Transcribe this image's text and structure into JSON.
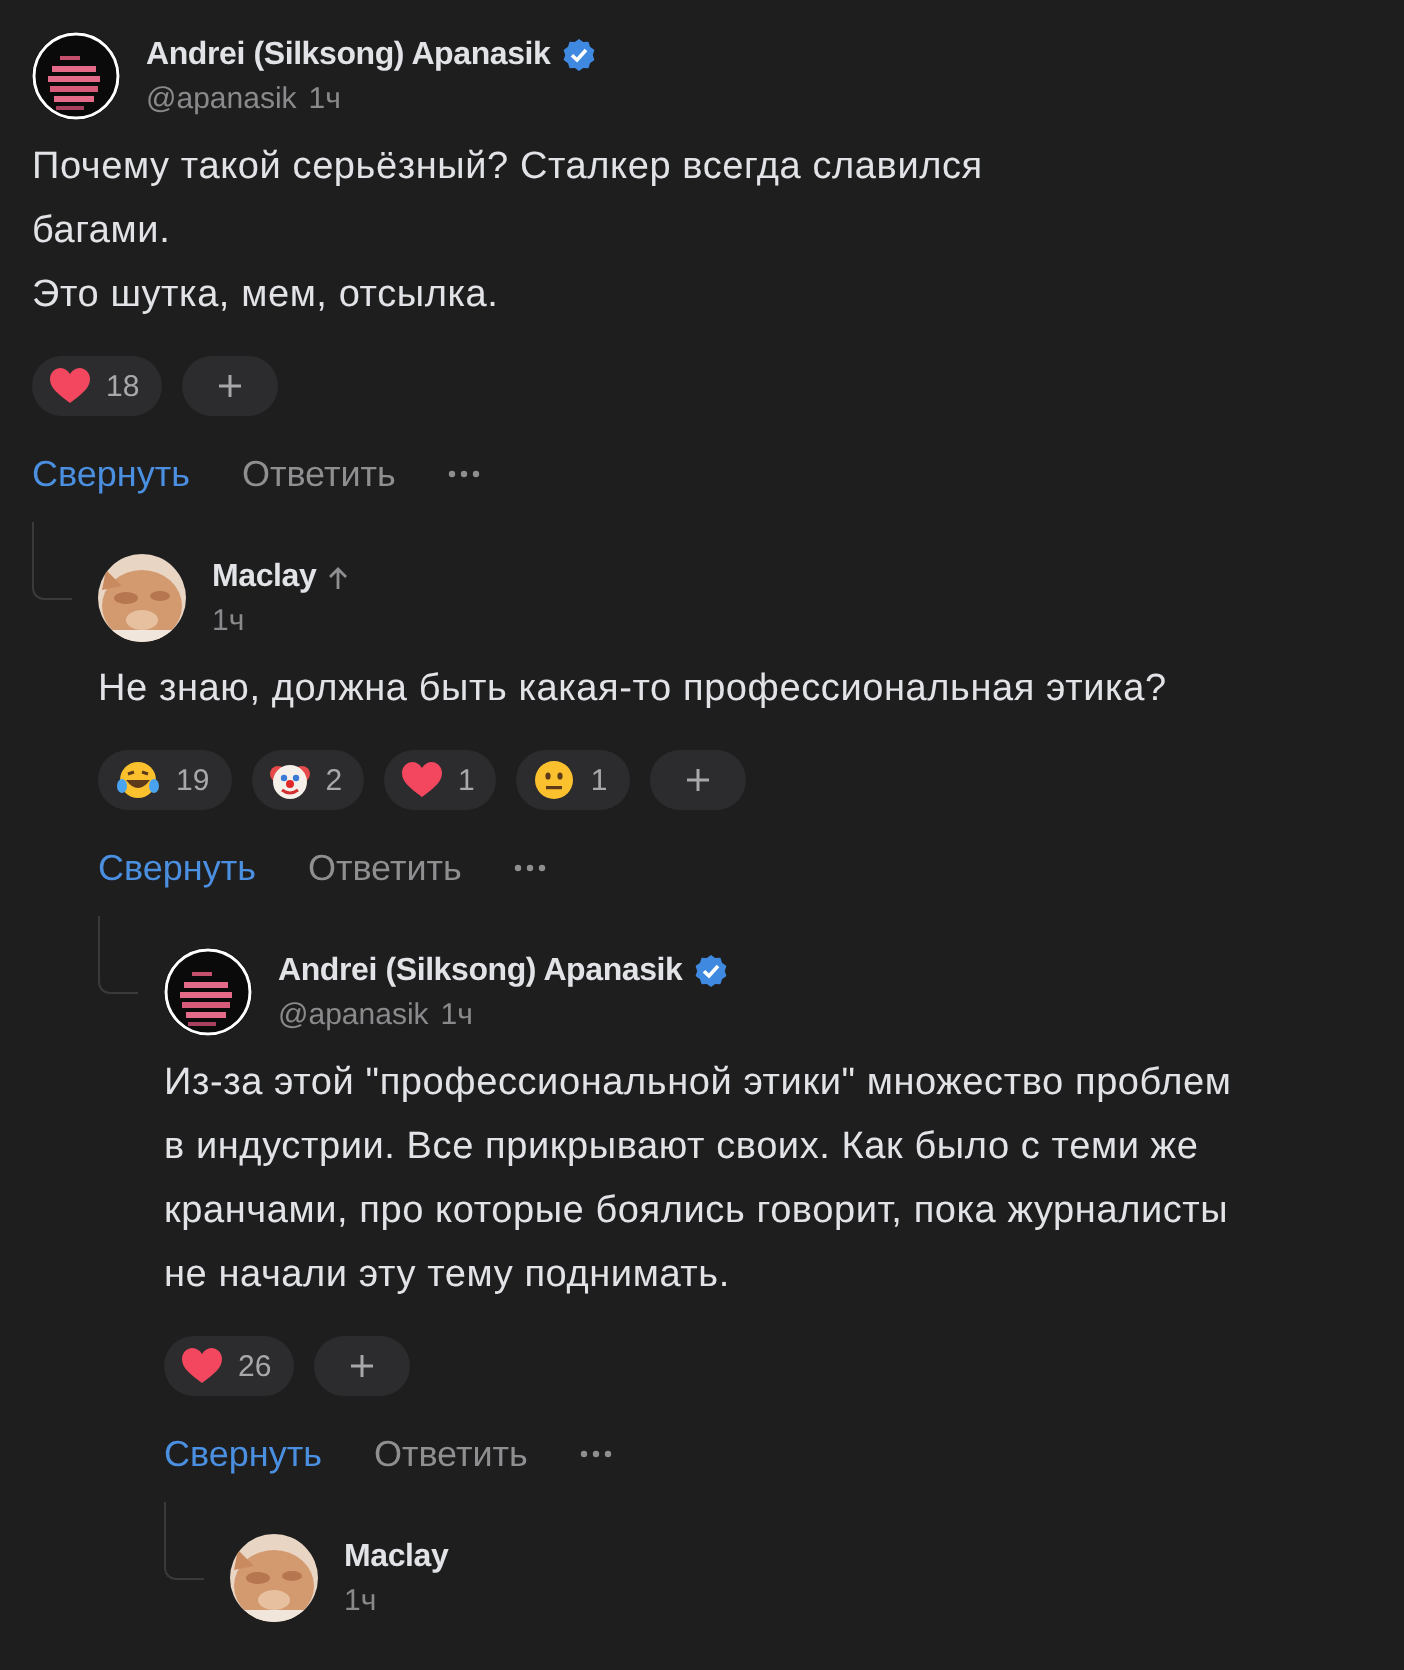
{
  "comments": [
    {
      "author": "Andrei (Silksong) Apanasik",
      "verified": true,
      "reply_marker": false,
      "handle": "@apanasik",
      "time": "1ч",
      "text": "Почему такой серьёзный? Сталкер всегда славился багами.\nЭто шутка, мем, отсылка.",
      "reactions": [
        {
          "kind": "heart",
          "count": "18"
        }
      ],
      "actions": {
        "collapse": "Свернуть",
        "reply": "Ответить"
      },
      "children": [
        {
          "author": "Maclay",
          "verified": false,
          "reply_marker": true,
          "time": "1ч",
          "text": "Не знаю, должна быть какая-то профессиональная этика?",
          "reactions": [
            {
              "kind": "laugh",
              "count": "19"
            },
            {
              "kind": "clown",
              "count": "2"
            },
            {
              "kind": "heart",
              "count": "1"
            },
            {
              "kind": "neutral",
              "count": "1"
            }
          ],
          "actions": {
            "collapse": "Свернуть",
            "reply": "Ответить"
          },
          "children": [
            {
              "author": "Andrei (Silksong) Apanasik",
              "verified": true,
              "reply_marker": false,
              "handle": "@apanasik",
              "time": "1ч",
              "text": "Из-за этой \"профессиональной этики\" множество проблем в индустрии. Все прикрывают своих. Как было с теми же кранчами, про которые боялись говорит, пока журналисты не начали эту тему поднимать.",
              "reactions": [
                {
                  "kind": "heart",
                  "count": "26"
                }
              ],
              "actions": {
                "collapse": "Свернуть",
                "reply": "Ответить"
              },
              "children": [
                {
                  "author": "Maclay",
                  "verified": false,
                  "reply_marker": false,
                  "time": "1ч"
                }
              ]
            }
          ]
        }
      ]
    }
  ]
}
